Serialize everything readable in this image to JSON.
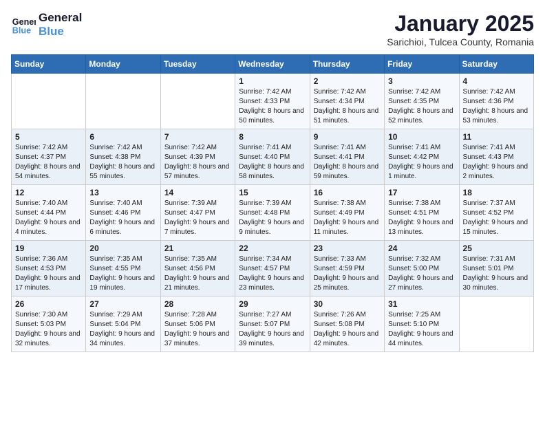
{
  "header": {
    "logo_line1": "General",
    "logo_line2": "Blue",
    "month": "January 2025",
    "location": "Sarichioi, Tulcea County, Romania"
  },
  "weekdays": [
    "Sunday",
    "Monday",
    "Tuesday",
    "Wednesday",
    "Thursday",
    "Friday",
    "Saturday"
  ],
  "weeks": [
    [
      {
        "day": "",
        "sunrise": "",
        "sunset": "",
        "daylight": ""
      },
      {
        "day": "",
        "sunrise": "",
        "sunset": "",
        "daylight": ""
      },
      {
        "day": "",
        "sunrise": "",
        "sunset": "",
        "daylight": ""
      },
      {
        "day": "1",
        "sunrise": "Sunrise: 7:42 AM",
        "sunset": "Sunset: 4:33 PM",
        "daylight": "Daylight: 8 hours and 50 minutes."
      },
      {
        "day": "2",
        "sunrise": "Sunrise: 7:42 AM",
        "sunset": "Sunset: 4:34 PM",
        "daylight": "Daylight: 8 hours and 51 minutes."
      },
      {
        "day": "3",
        "sunrise": "Sunrise: 7:42 AM",
        "sunset": "Sunset: 4:35 PM",
        "daylight": "Daylight: 8 hours and 52 minutes."
      },
      {
        "day": "4",
        "sunrise": "Sunrise: 7:42 AM",
        "sunset": "Sunset: 4:36 PM",
        "daylight": "Daylight: 8 hours and 53 minutes."
      }
    ],
    [
      {
        "day": "5",
        "sunrise": "Sunrise: 7:42 AM",
        "sunset": "Sunset: 4:37 PM",
        "daylight": "Daylight: 8 hours and 54 minutes."
      },
      {
        "day": "6",
        "sunrise": "Sunrise: 7:42 AM",
        "sunset": "Sunset: 4:38 PM",
        "daylight": "Daylight: 8 hours and 55 minutes."
      },
      {
        "day": "7",
        "sunrise": "Sunrise: 7:42 AM",
        "sunset": "Sunset: 4:39 PM",
        "daylight": "Daylight: 8 hours and 57 minutes."
      },
      {
        "day": "8",
        "sunrise": "Sunrise: 7:41 AM",
        "sunset": "Sunset: 4:40 PM",
        "daylight": "Daylight: 8 hours and 58 minutes."
      },
      {
        "day": "9",
        "sunrise": "Sunrise: 7:41 AM",
        "sunset": "Sunset: 4:41 PM",
        "daylight": "Daylight: 8 hours and 59 minutes."
      },
      {
        "day": "10",
        "sunrise": "Sunrise: 7:41 AM",
        "sunset": "Sunset: 4:42 PM",
        "daylight": "Daylight: 9 hours and 1 minute."
      },
      {
        "day": "11",
        "sunrise": "Sunrise: 7:41 AM",
        "sunset": "Sunset: 4:43 PM",
        "daylight": "Daylight: 9 hours and 2 minutes."
      }
    ],
    [
      {
        "day": "12",
        "sunrise": "Sunrise: 7:40 AM",
        "sunset": "Sunset: 4:44 PM",
        "daylight": "Daylight: 9 hours and 4 minutes."
      },
      {
        "day": "13",
        "sunrise": "Sunrise: 7:40 AM",
        "sunset": "Sunset: 4:46 PM",
        "daylight": "Daylight: 9 hours and 6 minutes."
      },
      {
        "day": "14",
        "sunrise": "Sunrise: 7:39 AM",
        "sunset": "Sunset: 4:47 PM",
        "daylight": "Daylight: 9 hours and 7 minutes."
      },
      {
        "day": "15",
        "sunrise": "Sunrise: 7:39 AM",
        "sunset": "Sunset: 4:48 PM",
        "daylight": "Daylight: 9 hours and 9 minutes."
      },
      {
        "day": "16",
        "sunrise": "Sunrise: 7:38 AM",
        "sunset": "Sunset: 4:49 PM",
        "daylight": "Daylight: 9 hours and 11 minutes."
      },
      {
        "day": "17",
        "sunrise": "Sunrise: 7:38 AM",
        "sunset": "Sunset: 4:51 PM",
        "daylight": "Daylight: 9 hours and 13 minutes."
      },
      {
        "day": "18",
        "sunrise": "Sunrise: 7:37 AM",
        "sunset": "Sunset: 4:52 PM",
        "daylight": "Daylight: 9 hours and 15 minutes."
      }
    ],
    [
      {
        "day": "19",
        "sunrise": "Sunrise: 7:36 AM",
        "sunset": "Sunset: 4:53 PM",
        "daylight": "Daylight: 9 hours and 17 minutes."
      },
      {
        "day": "20",
        "sunrise": "Sunrise: 7:35 AM",
        "sunset": "Sunset: 4:55 PM",
        "daylight": "Daylight: 9 hours and 19 minutes."
      },
      {
        "day": "21",
        "sunrise": "Sunrise: 7:35 AM",
        "sunset": "Sunset: 4:56 PM",
        "daylight": "Daylight: 9 hours and 21 minutes."
      },
      {
        "day": "22",
        "sunrise": "Sunrise: 7:34 AM",
        "sunset": "Sunset: 4:57 PM",
        "daylight": "Daylight: 9 hours and 23 minutes."
      },
      {
        "day": "23",
        "sunrise": "Sunrise: 7:33 AM",
        "sunset": "Sunset: 4:59 PM",
        "daylight": "Daylight: 9 hours and 25 minutes."
      },
      {
        "day": "24",
        "sunrise": "Sunrise: 7:32 AM",
        "sunset": "Sunset: 5:00 PM",
        "daylight": "Daylight: 9 hours and 27 minutes."
      },
      {
        "day": "25",
        "sunrise": "Sunrise: 7:31 AM",
        "sunset": "Sunset: 5:01 PM",
        "daylight": "Daylight: 9 hours and 30 minutes."
      }
    ],
    [
      {
        "day": "26",
        "sunrise": "Sunrise: 7:30 AM",
        "sunset": "Sunset: 5:03 PM",
        "daylight": "Daylight: 9 hours and 32 minutes."
      },
      {
        "day": "27",
        "sunrise": "Sunrise: 7:29 AM",
        "sunset": "Sunset: 5:04 PM",
        "daylight": "Daylight: 9 hours and 34 minutes."
      },
      {
        "day": "28",
        "sunrise": "Sunrise: 7:28 AM",
        "sunset": "Sunset: 5:06 PM",
        "daylight": "Daylight: 9 hours and 37 minutes."
      },
      {
        "day": "29",
        "sunrise": "Sunrise: 7:27 AM",
        "sunset": "Sunset: 5:07 PM",
        "daylight": "Daylight: 9 hours and 39 minutes."
      },
      {
        "day": "30",
        "sunrise": "Sunrise: 7:26 AM",
        "sunset": "Sunset: 5:08 PM",
        "daylight": "Daylight: 9 hours and 42 minutes."
      },
      {
        "day": "31",
        "sunrise": "Sunrise: 7:25 AM",
        "sunset": "Sunset: 5:10 PM",
        "daylight": "Daylight: 9 hours and 44 minutes."
      },
      {
        "day": "",
        "sunrise": "",
        "sunset": "",
        "daylight": ""
      }
    ]
  ]
}
